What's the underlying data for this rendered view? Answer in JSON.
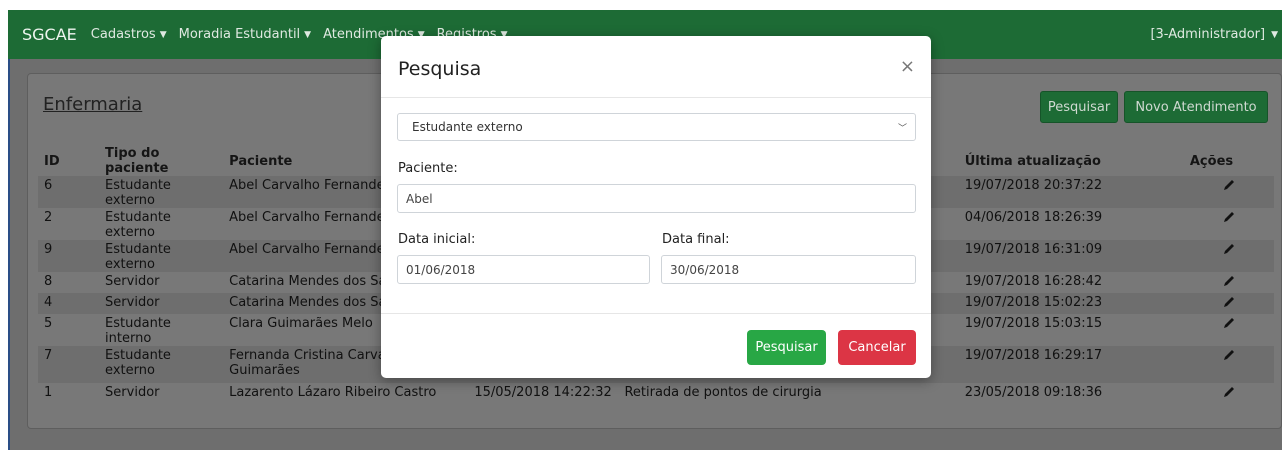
{
  "navbar": {
    "brand": "SGCAE",
    "items": [
      {
        "label": "Cadastros"
      },
      {
        "label": "Moradia Estudantil"
      },
      {
        "label": "Atendimentos"
      },
      {
        "label": "Registros"
      }
    ],
    "user": "[3-Administrador]"
  },
  "panel": {
    "title": "Enfermaria",
    "search_button": "Pesquisar",
    "new_button": "Novo Atendimento"
  },
  "table": {
    "headers": {
      "id": "ID",
      "tipo": "Tipo do paciente",
      "paciente": "Paciente",
      "atualizacao": "Última atualização",
      "acoes": "Ações"
    },
    "rows": [
      {
        "id": "6",
        "tipo": "Estudante externo",
        "paciente": "Abel Carvalho Fernandes",
        "data": "",
        "motivo": "",
        "atualizacao": "19/07/2018 20:37:22"
      },
      {
        "id": "2",
        "tipo": "Estudante externo",
        "paciente": "Abel Carvalho Fernandes",
        "data": "",
        "motivo": "",
        "atualizacao": "04/06/2018 18:26:39"
      },
      {
        "id": "9",
        "tipo": "Estudante externo",
        "paciente": "Abel Carvalho Fernandes",
        "data": "",
        "motivo": "",
        "atualizacao": "19/07/2018 16:31:09"
      },
      {
        "id": "8",
        "tipo": "Servidor",
        "paciente": "Catarina Mendes dos Sa",
        "data": "",
        "motivo": "",
        "atualizacao": "19/07/2018 16:28:42"
      },
      {
        "id": "4",
        "tipo": "Servidor",
        "paciente": "Catarina Mendes dos Sa",
        "data": "",
        "motivo": "",
        "atualizacao": "19/07/2018 15:02:23"
      },
      {
        "id": "5",
        "tipo": "Estudante interno",
        "paciente": "Clara Guimarães Melo",
        "data": "",
        "motivo": "",
        "atualizacao": "19/07/2018 15:03:15"
      },
      {
        "id": "7",
        "tipo": "Estudante externo",
        "paciente": "Fernanda Cristina Carval\nGuimarães",
        "data": "",
        "motivo": "",
        "atualizacao": "19/07/2018 16:29:17"
      },
      {
        "id": "1",
        "tipo": "Servidor",
        "paciente": "Lazarento Lázaro Ribeiro Castro",
        "data": "15/05/2018 14:22:32",
        "motivo": "Retirada de pontos de cirurgia",
        "atualizacao": "23/05/2018 09:18:36"
      }
    ]
  },
  "modal": {
    "title": "Pesquisa",
    "close": "×",
    "patient_type_selected": "Estudante externo",
    "paciente_label": "Paciente:",
    "paciente_value": "Abel",
    "data_inicial_label": "Data inicial:",
    "data_inicial_value": "01/06/2018",
    "data_final_label": "Data final:",
    "data_final_value": "30/06/2018",
    "search_button": "Pesquisar",
    "cancel_button": "Cancelar"
  },
  "colors": {
    "navbar": "#1d6b35",
    "success": "#28a745",
    "danger": "#dc3545"
  }
}
